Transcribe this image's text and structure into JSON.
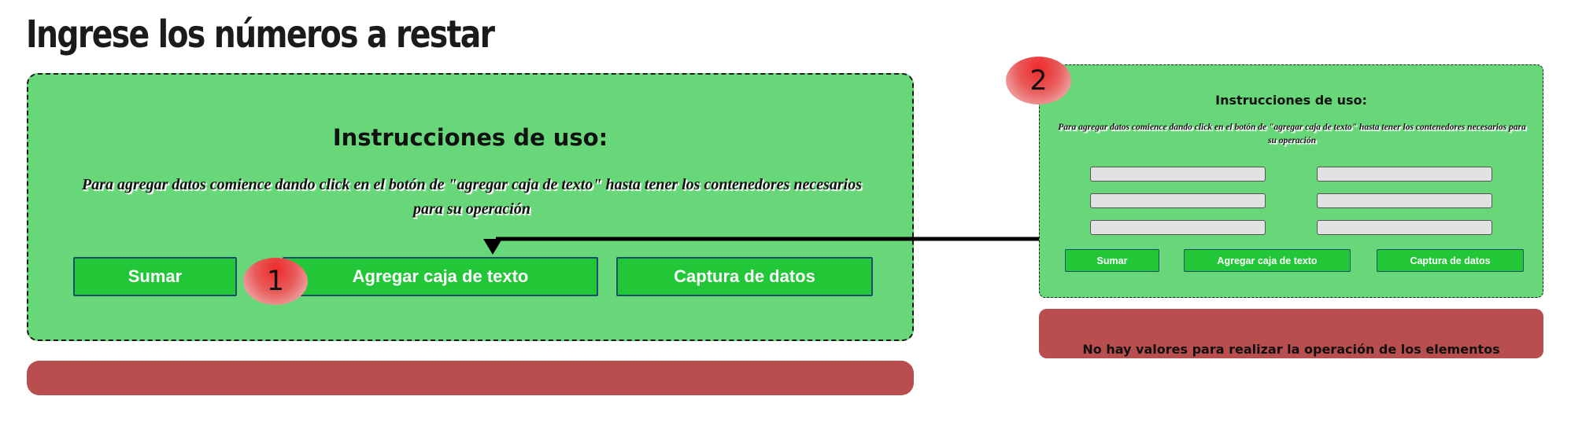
{
  "page_title": "Ingrese los números a restar",
  "instructions": {
    "heading": "Instrucciones de uso:",
    "text": "Para agregar datos comience dando click en el botón de \"agregar caja de texto\" hasta tener los contenedores necesarios para su operación"
  },
  "buttons": {
    "sumar": "Sumar",
    "agregar": "Agregar caja de texto",
    "captura": "Captura de datos"
  },
  "result_message": "No hay valores para realizar la operación de los elementos",
  "markers": [
    "1",
    "2"
  ],
  "colors": {
    "panel": "#67d779",
    "button": "#22c737",
    "button_border": "#154f6a",
    "result_bar": "#b94e4e",
    "input_bg": "#e1e1e1"
  }
}
